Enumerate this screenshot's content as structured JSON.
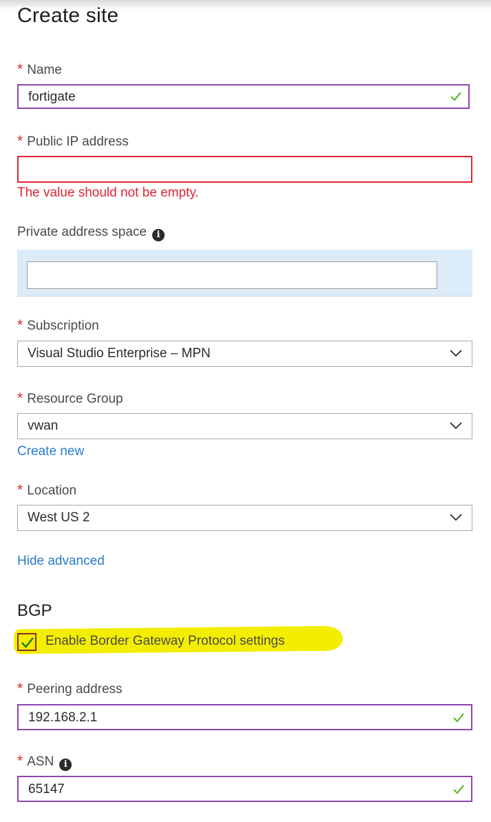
{
  "page": {
    "title": "Create site"
  },
  "name": {
    "label": "Name",
    "value": "fortigate"
  },
  "public_ip": {
    "label": "Public IP address",
    "value": "",
    "error": "The value should not be empty."
  },
  "private_space": {
    "label": "Private address space",
    "value": ""
  },
  "subscription": {
    "label": "Subscription",
    "value": "Visual Studio Enterprise – MPN"
  },
  "resource_group": {
    "label": "Resource Group",
    "value": "vwan",
    "create_new": "Create new"
  },
  "location": {
    "label": "Location",
    "value": "West US 2"
  },
  "advanced": {
    "toggle_label": "Hide advanced"
  },
  "bgp": {
    "heading": "BGP",
    "enable_label": "Enable Border Gateway Protocol settings",
    "enabled": true
  },
  "peering": {
    "label": "Peering address",
    "value": "192.168.2.1"
  },
  "asn": {
    "label": "ASN",
    "value": "65147"
  },
  "icons": {
    "required": "asterisk",
    "valid": "check-icon",
    "dropdown": "chevron-down-icon",
    "info": "info-icon"
  },
  "colors": {
    "required": "#e3222c",
    "error": "#e02433",
    "valid": "#5fb832",
    "link": "#2a7ccc",
    "focus_border": "#8e44ad",
    "highlight": "#f3ee00"
  }
}
